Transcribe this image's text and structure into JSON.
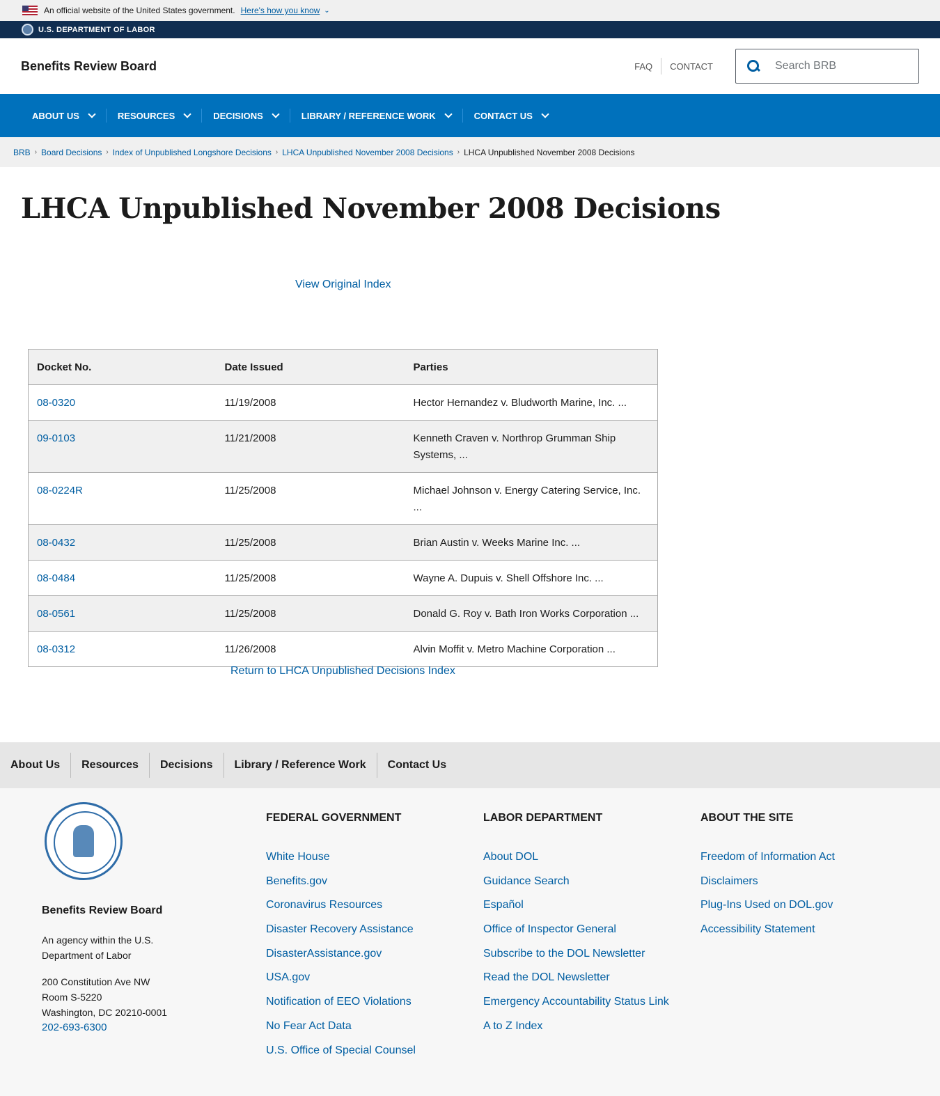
{
  "gov_banner": {
    "official_text": "An official website of the United States government.",
    "how_you_know": "Here's how you know"
  },
  "agency_bar": {
    "label": "U.S. DEPARTMENT OF LABOR"
  },
  "header": {
    "site_title": "Benefits Review Board",
    "faq": "FAQ",
    "contact": "CONTACT",
    "search_placeholder": "Search BRB"
  },
  "main_nav": [
    {
      "label": "ABOUT US"
    },
    {
      "label": "RESOURCES"
    },
    {
      "label": "DECISIONS"
    },
    {
      "label": "LIBRARY / REFERENCE WORK"
    },
    {
      "label": "CONTACT US"
    }
  ],
  "breadcrumb": {
    "items": [
      "BRB",
      "Board Decisions",
      "Index of Unpublished Longshore Decisions",
      "LHCA Unpublished November 2008 Decisions"
    ],
    "current": "LHCA Unpublished November 2008 Decisions"
  },
  "page": {
    "title": "LHCA Unpublished November 2008 Decisions",
    "view_original": "View Original Index",
    "return_link": "Return to LHCA Unpublished Decisions Index"
  },
  "table": {
    "headers": [
      "Docket No.",
      "Date Issued",
      "Parties"
    ],
    "rows": [
      {
        "docket": "08-0320",
        "date": "11/19/2008",
        "parties": "Hector Hernandez v. Bludworth Marine, Inc. ..."
      },
      {
        "docket": "09-0103",
        "date": "11/21/2008",
        "parties": "Kenneth Craven v. Northrop Grumman Ship Systems, ..."
      },
      {
        "docket": "08-0224R",
        "date": "11/25/2008",
        "parties": "Michael Johnson v. Energy Catering Service, Inc. ..."
      },
      {
        "docket": "08-0432",
        "date": "11/25/2008",
        "parties": "Brian Austin v. Weeks Marine Inc. ..."
      },
      {
        "docket": "08-0484",
        "date": "11/25/2008",
        "parties": "Wayne A. Dupuis v. Shell Offshore Inc. ..."
      },
      {
        "docket": "08-0561",
        "date": "11/25/2008",
        "parties": "Donald G. Roy v. Bath Iron Works Corporation ..."
      },
      {
        "docket": "08-0312",
        "date": "11/26/2008",
        "parties": "Alvin Moffit v. Metro Machine Corporation ..."
      }
    ]
  },
  "footer_nav": [
    "About Us",
    "Resources",
    "Decisions",
    "Library / Reference Work",
    "Contact Us"
  ],
  "footer": {
    "agency_name": "Benefits Review Board",
    "agency_desc": "An agency within the U.S. Department of Labor",
    "address_lines": [
      "200 Constitution Ave NW",
      "Room S-5220",
      "Washington, DC 20210-0001"
    ],
    "phone": "202-693-6300",
    "columns": [
      {
        "heading": "FEDERAL GOVERNMENT",
        "links": [
          "White House",
          "Benefits.gov",
          "Coronavirus Resources",
          "Disaster Recovery Assistance",
          "DisasterAssistance.gov",
          "USA.gov",
          "Notification of EEO Violations",
          "No Fear Act Data",
          "U.S. Office of Special Counsel"
        ]
      },
      {
        "heading": "LABOR DEPARTMENT",
        "links": [
          "About DOL",
          "Guidance Search",
          "Español",
          "Office of Inspector General",
          "Subscribe to the DOL Newsletter",
          "Read the DOL Newsletter",
          "Emergency Accountability Status Link",
          "A to Z Index"
        ]
      },
      {
        "heading": "ABOUT THE SITE",
        "links": [
          "Freedom of Information Act",
          "Disclaimers",
          "Plug-Ins Used on DOL.gov",
          "Accessibility Statement"
        ]
      }
    ]
  }
}
